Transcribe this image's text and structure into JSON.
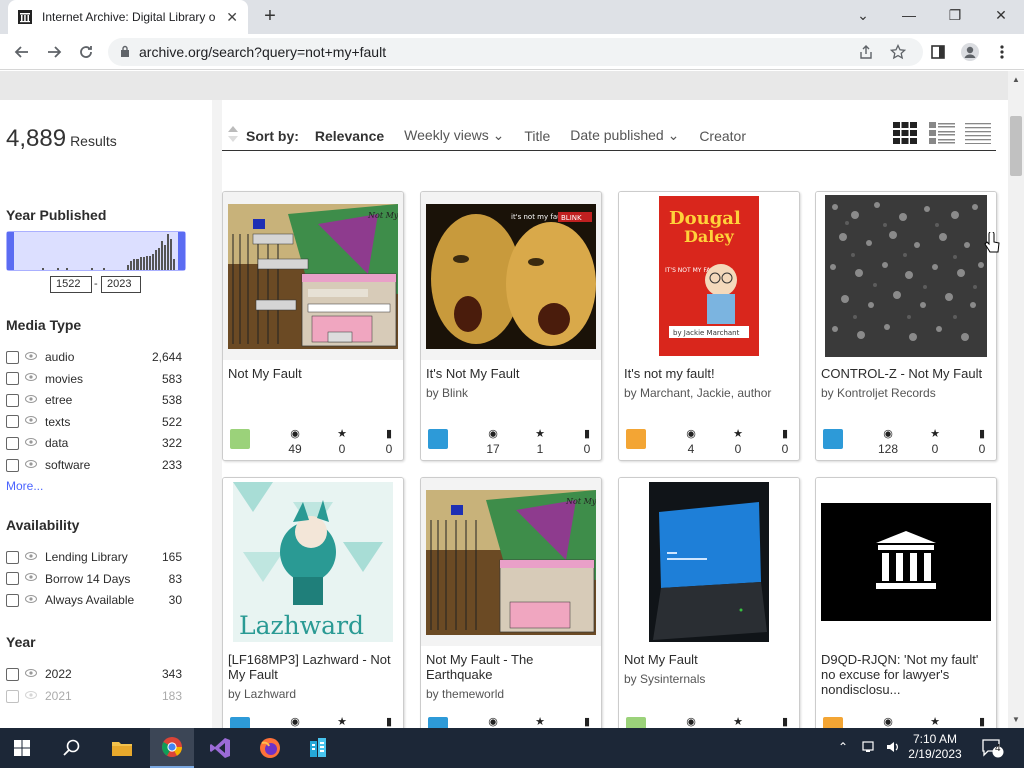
{
  "browser": {
    "tab_title": "Internet Archive: Digital Library o",
    "url": "archive.org/search?query=not+my+fault"
  },
  "sidebar": {
    "results_count": "4,889",
    "results_label": "Results",
    "year_published_heading": "Year Published",
    "year_from": "1522",
    "year_to": "2023",
    "year_separator": "-",
    "histogram": [
      0,
      0,
      0,
      0,
      0,
      0,
      0,
      0,
      0.05,
      0,
      0,
      0,
      0,
      0.05,
      0,
      0,
      0.05,
      0,
      0,
      0,
      0,
      0,
      0,
      0,
      0.05,
      0,
      0,
      0,
      0.05,
      0,
      0,
      0,
      0,
      0,
      0,
      0,
      0.15,
      0.25,
      0.3,
      0.3,
      0.35,
      0.35,
      0.4,
      0.4,
      0.45,
      0.55,
      0.6,
      0.8,
      0.7,
      1.0,
      0.85,
      0.3
    ],
    "media_type_heading": "Media Type",
    "media_types": [
      {
        "label": "audio",
        "count": "2,644"
      },
      {
        "label": "movies",
        "count": "583"
      },
      {
        "label": "etree",
        "count": "538"
      },
      {
        "label": "texts",
        "count": "522"
      },
      {
        "label": "data",
        "count": "322"
      },
      {
        "label": "software",
        "count": "233"
      }
    ],
    "more_label": "More...",
    "availability_heading": "Availability",
    "availability": [
      {
        "label": "Lending Library",
        "count": "165"
      },
      {
        "label": "Borrow 14 Days",
        "count": "83"
      },
      {
        "label": "Always Available",
        "count": "30"
      }
    ],
    "year_heading": "Year",
    "years": [
      {
        "label": "2022",
        "count": "343"
      },
      {
        "label": "2021",
        "count": "183"
      }
    ]
  },
  "sortbar": {
    "sort_by_label": "Sort by:",
    "options": [
      "Relevance",
      "Weekly views",
      "Title",
      "Date published",
      "Creator"
    ]
  },
  "cards": [
    {
      "title": "Not My Fault",
      "by": "",
      "views": "49",
      "favs": "0",
      "reviews": "0",
      "media": "software"
    },
    {
      "title": "It's Not My Fault",
      "by": "by Blink",
      "views": "17",
      "favs": "1",
      "reviews": "0",
      "media": "audio"
    },
    {
      "title": "It's not my fault!",
      "by": "by Marchant, Jackie, author",
      "views": "4",
      "favs": "0",
      "reviews": "0",
      "media": "texts"
    },
    {
      "title": "CONTROL-Z - Not My Fault",
      "by": "by Kontroljet Records",
      "views": "128",
      "favs": "0",
      "reviews": "0",
      "media": "audio"
    },
    {
      "title": "[LF168MP3] Lazhward - Not My Fault",
      "by": "by Lazhward",
      "media": "audio"
    },
    {
      "title": "Not My Fault - The Earthquake",
      "by": "by themeworld",
      "media": "audio"
    },
    {
      "title": "Not My Fault",
      "by": "by Sysinternals",
      "media": "software"
    },
    {
      "title": "D9QD-RJQN: 'Not my fault' no excuse for lawyer's nondisclosu...",
      "by": "",
      "media": "texts"
    }
  ],
  "thumb_text": {
    "card1": "Not My Fault",
    "card2": "it's not my fault!",
    "card2_badge": "BLINK",
    "card3_line1": "Dougal",
    "card3_line2": "Daley",
    "card3_line3": "IT'S NOT MY FAULT!",
    "card3_author": "by Jackie Marchant",
    "card5": "Lazhward"
  },
  "taskbar": {
    "time": "7:10 AM",
    "date": "2/19/2023",
    "notification_count": "4"
  }
}
